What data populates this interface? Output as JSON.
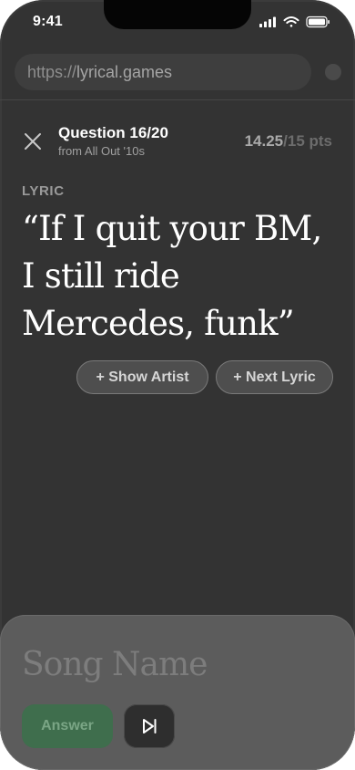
{
  "status_bar": {
    "time": "9:41",
    "icons": [
      "signal-icon",
      "wifi-icon",
      "battery-icon"
    ]
  },
  "browser": {
    "url_scheme": "https://",
    "url_host": "lyrical.games"
  },
  "header": {
    "question": "Question 16/20",
    "source": "from All Out '10s",
    "score": "14.25",
    "score_total": "/15 pts"
  },
  "lyric": {
    "label": "LYRIC",
    "text": "“If I quit your BM, I still ride Mercedes, funk”"
  },
  "hints": {
    "show_artist": "+ Show Artist",
    "next_lyric": "+ Next Lyric"
  },
  "answer": {
    "placeholder": "Song Name",
    "value": "",
    "submit_label": "Answer",
    "skip_icon": "skip-next-icon"
  },
  "colors": {
    "background": "#333333",
    "sheet": "#5c5c5c",
    "answer_button": "#3f6e4d"
  }
}
